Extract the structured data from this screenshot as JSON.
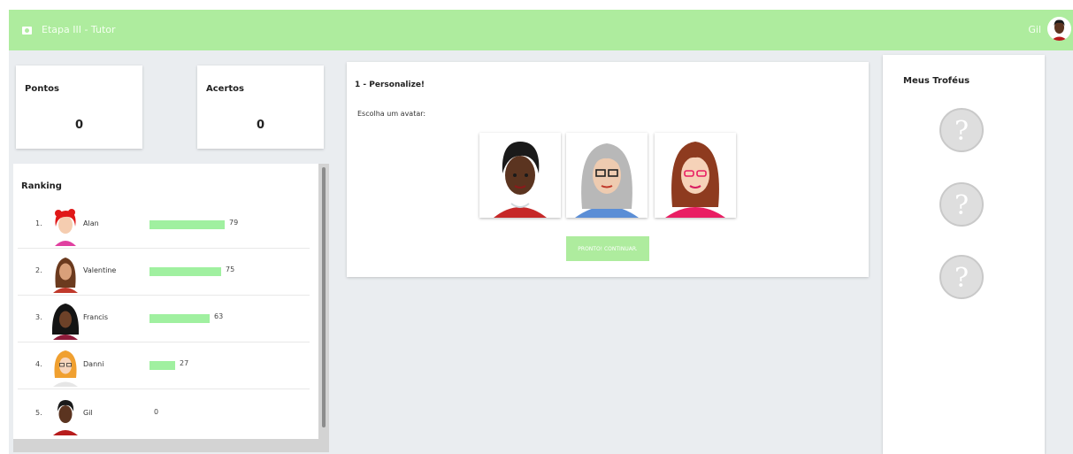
{
  "header": {
    "app_icon": "camera-icon",
    "title": "Etapa III - Tutor",
    "user_name": "Gil",
    "accent_color": "#aeec9e"
  },
  "stats": [
    {
      "title": "Pontos",
      "value": "0"
    },
    {
      "title": "Acertos",
      "value": "0"
    }
  ],
  "ranking": {
    "title": "Ranking",
    "rows": [
      {
        "rank": "1.",
        "name": "Alan",
        "score": 79,
        "score_label": "79"
      },
      {
        "rank": "2.",
        "name": "Valentine",
        "score": 75,
        "score_label": "75"
      },
      {
        "rank": "3.",
        "name": "Francis",
        "score": 63,
        "score_label": "63"
      },
      {
        "rank": "4.",
        "name": "Danni",
        "score": 27,
        "score_label": "27"
      },
      {
        "rank": "5.",
        "name": "Gil",
        "score": 0,
        "score_label": "0"
      }
    ]
  },
  "question": {
    "title": "1 - Personalize!",
    "prompt": "Escolha um avatar:",
    "avatars": [
      "dark-short-hair-avatar",
      "gray-hair-glasses-avatar",
      "red-hair-glasses-avatar"
    ],
    "continue_label": "PRONTO! CONTINUAR."
  },
  "trophies": {
    "title": "Meus Troféus",
    "items": [
      "locked-trophy-icon",
      "locked-trophy-icon",
      "locked-trophy-icon"
    ]
  }
}
